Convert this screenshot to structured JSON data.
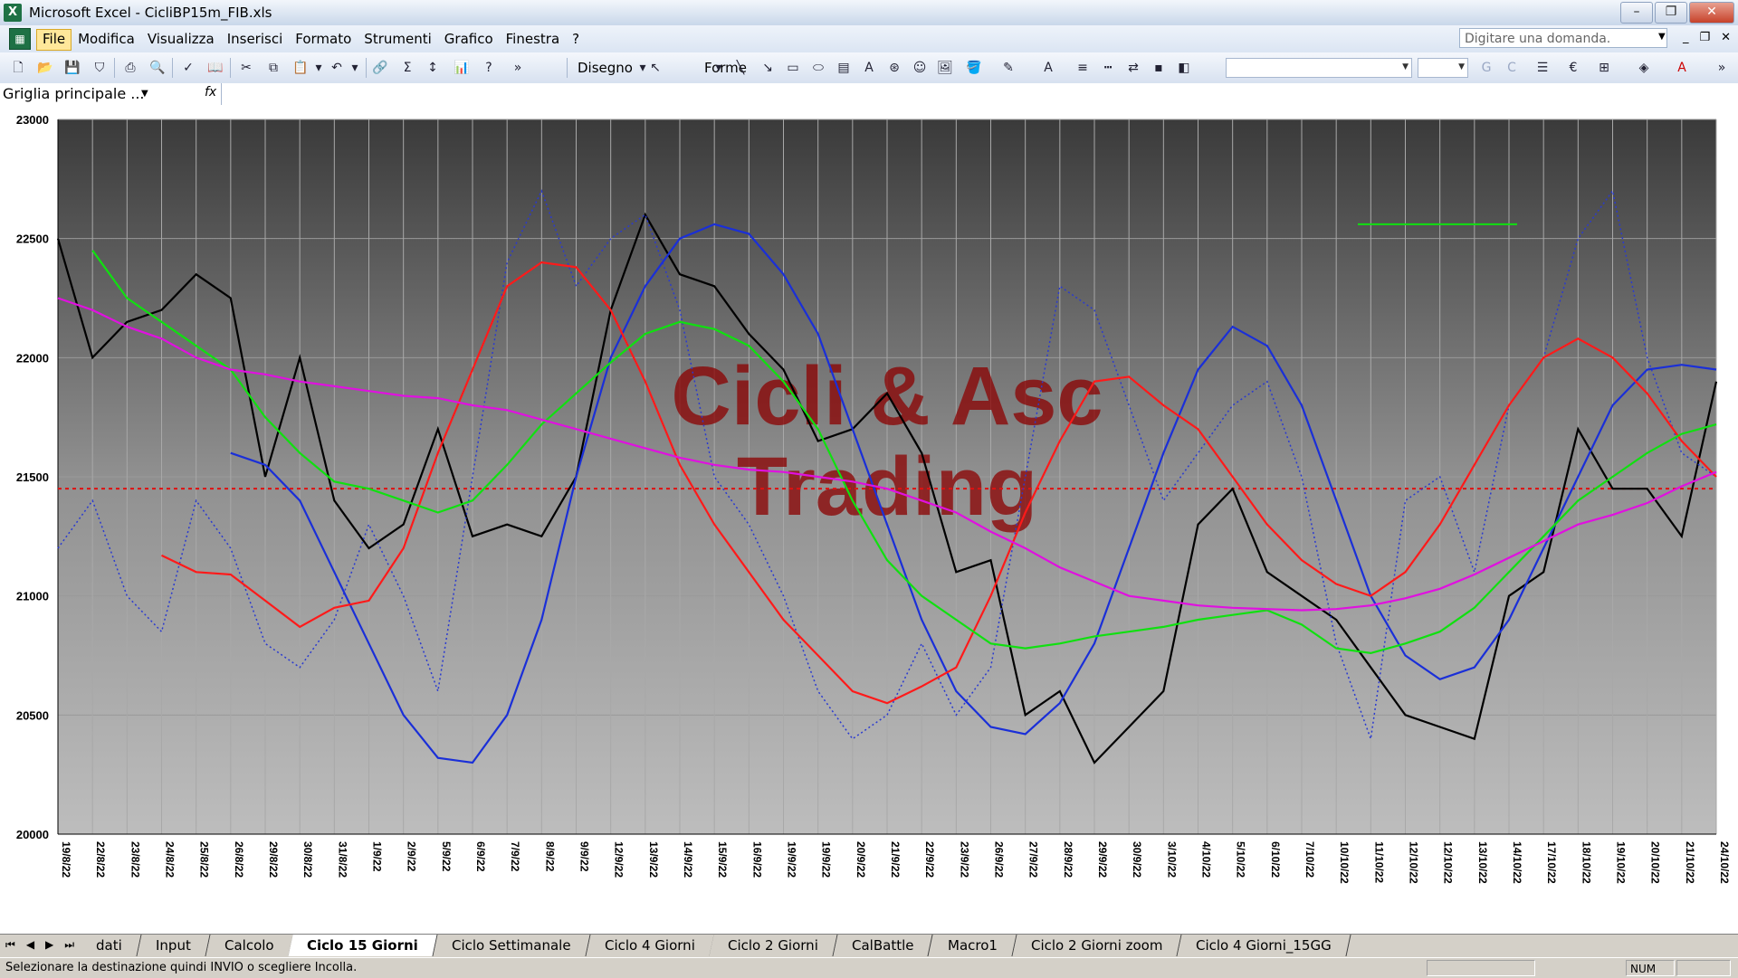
{
  "titlebar": {
    "app": "Microsoft Excel",
    "file": "CicliBP15m_FIB.xls",
    "title": "Microsoft Excel - CicliBP15m_FIB.xls"
  },
  "menu": [
    "File",
    "Modifica",
    "Visualizza",
    "Inserisci",
    "Formato",
    "Strumenti",
    "Grafico",
    "Finestra",
    "?"
  ],
  "help": {
    "placeholder": "Digitare una domanda."
  },
  "toolbar": {
    "draw_label": "Disegno",
    "shapes_label": "Forme"
  },
  "namebox": {
    "value": "Griglia principale ...",
    "fx": "fx"
  },
  "colors": {
    "black": "#000000",
    "red": "#ff1a1a",
    "green": "#10e010",
    "blue": "#1a2fd8",
    "magenta": "#e010e0",
    "dotted_blue": "#2a3ad0",
    "ref_line": "#e01010",
    "watermark": "#8b0000"
  },
  "chart_data": {
    "type": "line",
    "watermark": [
      "Cicli & Asc",
      "Trading"
    ],
    "ylim": [
      20000,
      23000
    ],
    "yticks": [
      "23000",
      "22500",
      "22000",
      "21500",
      "21000",
      "20500",
      "20000"
    ],
    "x_labels": [
      "19/8/22",
      "22/8/22",
      "23/8/22",
      "24/8/22",
      "25/8/22",
      "26/8/22",
      "29/8/22",
      "30/8/22",
      "31/8/22",
      "1/9/22",
      "2/9/22",
      "5/9/22",
      "6/9/22",
      "7/9/22",
      "8/9/22",
      "9/9/22",
      "12/9/22",
      "13/9/22",
      "14/9/22",
      "15/9/22",
      "16/9/22",
      "19/9/22",
      "19/9/22",
      "20/9/22",
      "21/9/22",
      "22/9/22",
      "23/9/22",
      "26/9/22",
      "27/9/22",
      "28/9/22",
      "29/9/22",
      "30/9/22",
      "3/10/22",
      "4/10/22",
      "5/10/22",
      "6/10/22",
      "7/10/22",
      "10/10/22",
      "11/10/22",
      "12/10/22",
      "12/10/22",
      "13/10/22",
      "14/10/22",
      "17/10/22",
      "18/10/22",
      "19/10/22",
      "20/10/22",
      "21/10/22",
      "24/10/22"
    ],
    "reference_line": 21450,
    "series": [
      {
        "color": "black",
        "style": "solid",
        "values": [
          22500,
          22000,
          22150,
          22200,
          22350,
          22250,
          21500,
          22000,
          21400,
          21200,
          21300,
          21700,
          21250,
          21300,
          21250,
          21500,
          22200,
          22600,
          22350,
          22300,
          22100,
          21950,
          21650,
          21700,
          21850,
          21600,
          21100,
          21150,
          20500,
          20600,
          20300,
          20450,
          20600,
          21300,
          21450,
          21100,
          21000,
          20900,
          20700,
          20500,
          20450,
          20400,
          21000,
          21100,
          21700,
          21450,
          21450,
          21250,
          21900
        ]
      },
      {
        "color": "dotted_blue",
        "style": "dotted",
        "values": [
          21200,
          21400,
          21000,
          20850,
          21400,
          21200,
          20800,
          20700,
          20900,
          21300,
          21000,
          20600,
          21500,
          22400,
          22700,
          22300,
          22500,
          22600,
          22200,
          21500,
          21300,
          21000,
          20600,
          20400,
          20500,
          20800,
          20500,
          20700,
          21500,
          22300,
          22200,
          21800,
          21400,
          21600,
          21800,
          21900,
          21500,
          20800,
          20400,
          21400,
          21500,
          21100,
          21800,
          22000,
          22500,
          22700,
          22000,
          21600,
          21500
        ]
      },
      {
        "color": "blue",
        "style": "solid",
        "values": [
          null,
          null,
          null,
          null,
          null,
          21600,
          21550,
          21400,
          21100,
          20800,
          20500,
          20320,
          20300,
          20500,
          20900,
          21500,
          22000,
          22300,
          22500,
          22560,
          22520,
          22350,
          22100,
          21700,
          21300,
          20900,
          20600,
          20450,
          20420,
          20550,
          20800,
          21200,
          21600,
          21950,
          22130,
          22050,
          21800,
          21400,
          21000,
          20750,
          20650,
          20700,
          20900,
          21200,
          21500,
          21800,
          21950,
          21970,
          21950
        ]
      },
      {
        "color": "red",
        "style": "solid",
        "values": [
          null,
          null,
          null,
          21170,
          21100,
          21090,
          20980,
          20870,
          20950,
          20980,
          21200,
          21600,
          21950,
          22300,
          22400,
          22380,
          22200,
          21900,
          21550,
          21300,
          21100,
          20900,
          20750,
          20600,
          20550,
          20620,
          20700,
          21000,
          21350,
          21650,
          21900,
          21920,
          21800,
          21700,
          21500,
          21300,
          21150,
          21050,
          21000,
          21100,
          21300,
          21550,
          21800,
          22000,
          22080,
          22000,
          21850,
          21650,
          21500
        ]
      },
      {
        "color": "green",
        "style": "solid",
        "values": [
          null,
          22450,
          22250,
          22150,
          22050,
          21950,
          21750,
          21600,
          21480,
          21450,
          21400,
          21350,
          21400,
          21550,
          21720,
          21850,
          21980,
          22100,
          22150,
          22120,
          22050,
          21900,
          21700,
          21400,
          21150,
          21000,
          20900,
          20800,
          20780,
          20800,
          20830,
          20850,
          20870,
          20900,
          20920,
          20940,
          20880,
          20780,
          20760,
          20800,
          20850,
          20950,
          21100,
          21250,
          21400,
          21500,
          21600,
          21680,
          21720
        ]
      },
      {
        "color": "magenta",
        "style": "solid",
        "values": [
          22250,
          22200,
          22130,
          22080,
          22000,
          21950,
          21930,
          21900,
          21880,
          21860,
          21840,
          21830,
          21800,
          21780,
          21740,
          21700,
          21660,
          21620,
          21580,
          21550,
          21530,
          21520,
          21500,
          21480,
          21450,
          21400,
          21350,
          21270,
          21200,
          21120,
          21060,
          21000,
          20980,
          20960,
          20950,
          20945,
          20940,
          20945,
          20960,
          20990,
          21030,
          21090,
          21160,
          21230,
          21300,
          21340,
          21390,
          21460,
          21520
        ]
      }
    ]
  },
  "sheet_tabs": [
    "dati",
    "Input",
    "Calcolo",
    "Ciclo 15 Giorni",
    "Ciclo Settimanale",
    "Ciclo 4 Giorni",
    "Ciclo 2 Giorni",
    "CalBattle",
    "Macro1",
    "Ciclo 2 Giorni zoom",
    "Ciclo 4 Giorni_15GG"
  ],
  "active_tab": "Ciclo 15 Giorni",
  "status": {
    "message": "Selezionare la destinazione quindi INVIO o scegliere Incolla.",
    "num": "NUM"
  }
}
